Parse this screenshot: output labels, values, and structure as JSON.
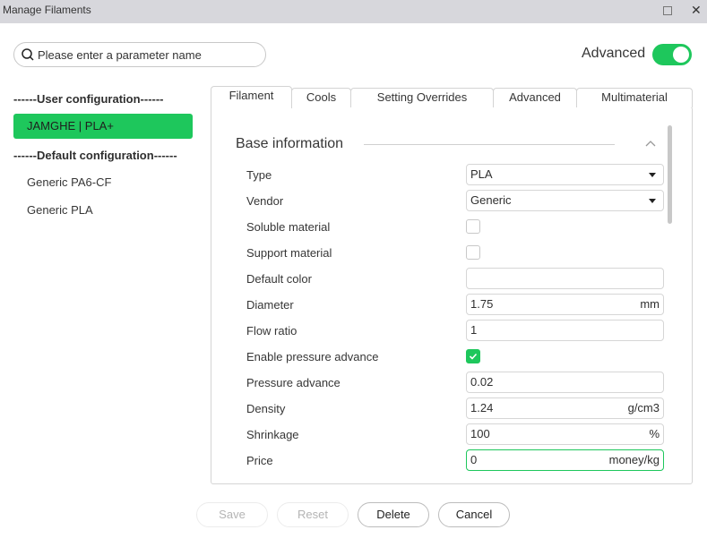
{
  "window": {
    "title": "Manage Filaments",
    "maximize_icon": "maximize-icon",
    "close_icon": "close-icon",
    "close_glyph": "✕"
  },
  "search": {
    "placeholder": "Please enter a parameter name",
    "value": "",
    "icon": "search-icon"
  },
  "advanced_toggle": {
    "label": "Advanced",
    "on": true
  },
  "sidebar": {
    "user_header": "------User configuration------",
    "user_items": [
      {
        "label": "JAMGHE | PLA+",
        "selected": true
      }
    ],
    "default_header": "------Default configuration------",
    "default_items": [
      {
        "label": "Generic PA6-CF",
        "selected": false
      },
      {
        "label": "Generic PLA",
        "selected": false
      }
    ]
  },
  "tabs": [
    {
      "label": "Filament",
      "active": true
    },
    {
      "label": "Cools",
      "active": false
    },
    {
      "label": "Setting Overrides",
      "active": false
    },
    {
      "label": "Advanced",
      "active": false
    },
    {
      "label": "Multimaterial",
      "active": false
    }
  ],
  "section": {
    "title": "Base information",
    "collapse_icon": "chevron-up-icon"
  },
  "fields": {
    "type": {
      "label": "Type",
      "value": "PLA"
    },
    "vendor": {
      "label": "Vendor",
      "value": "Generic"
    },
    "soluble": {
      "label": "Soluble material",
      "checked": false
    },
    "support": {
      "label": "Support material",
      "checked": false
    },
    "default_color": {
      "label": "Default color",
      "value": ""
    },
    "diameter": {
      "label": "Diameter",
      "value": "1.75",
      "unit": "mm"
    },
    "flow_ratio": {
      "label": "Flow ratio",
      "value": "1"
    },
    "enable_pa": {
      "label": "Enable pressure advance",
      "checked": true
    },
    "pressure_advance": {
      "label": "Pressure advance",
      "value": "0.02"
    },
    "density": {
      "label": "Density",
      "value": "1.24",
      "unit": "g/cm3"
    },
    "shrinkage": {
      "label": "Shrinkage",
      "value": "100",
      "unit": "%"
    },
    "price": {
      "label": "Price",
      "value": "0",
      "unit": "money/kg"
    }
  },
  "buttons": {
    "save": "Save",
    "reset": "Reset",
    "delete": "Delete",
    "cancel": "Cancel"
  },
  "colors": {
    "accent": "#1ec75c"
  }
}
